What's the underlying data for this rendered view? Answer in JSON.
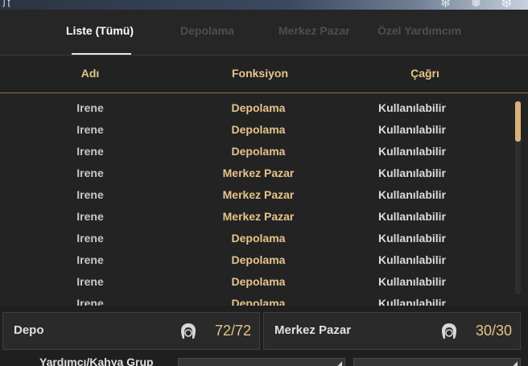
{
  "header": {
    "corner_glyph": "ʃ ʈ",
    "decoration": "❄ ❅ ❆"
  },
  "tabs": [
    {
      "label": "Liste (Tümü)",
      "active": true
    },
    {
      "label": "Depolama",
      "active": false
    },
    {
      "label": "Merkez Pazar",
      "active": false
    },
    {
      "label": "Özel Yardımcım",
      "active": false
    }
  ],
  "columns": {
    "name": "Adı",
    "function": "Fonksiyon",
    "call": "Çağrı"
  },
  "rows": [
    {
      "name": "Irene",
      "function": "Depolama",
      "call": "Kullanılabilir"
    },
    {
      "name": "Irene",
      "function": "Depolama",
      "call": "Kullanılabilir"
    },
    {
      "name": "Irene",
      "function": "Depolama",
      "call": "Kullanılabilir"
    },
    {
      "name": "Irene",
      "function": "Merkez Pazar",
      "call": "Kullanılabilir"
    },
    {
      "name": "Irene",
      "function": "Merkez Pazar",
      "call": "Kullanılabilir"
    },
    {
      "name": "Irene",
      "function": "Merkez Pazar",
      "call": "Kullanılabilir"
    },
    {
      "name": "Irene",
      "function": "Depolama",
      "call": "Kullanılabilir"
    },
    {
      "name": "Irene",
      "function": "Depolama",
      "call": "Kullanılabilir"
    },
    {
      "name": "Irene",
      "function": "Depolama",
      "call": "Kullanılabilir"
    },
    {
      "name": "Irene",
      "function": "Depolama",
      "call": "Kullanılabilir"
    }
  ],
  "storage_box": {
    "label": "Depo",
    "icon": "maid-head-icon",
    "count": "72/72"
  },
  "market_box": {
    "label": "Merkez Pazar",
    "icon": "maid-head-icon",
    "count": "30/30"
  },
  "footer": {
    "label": "Yardımcı/Kahya Grup"
  },
  "colors": {
    "accent": "#e6c48a",
    "active_tab": "#ffffff",
    "inactive_tab": "#4a4f56",
    "background": "#242424"
  }
}
